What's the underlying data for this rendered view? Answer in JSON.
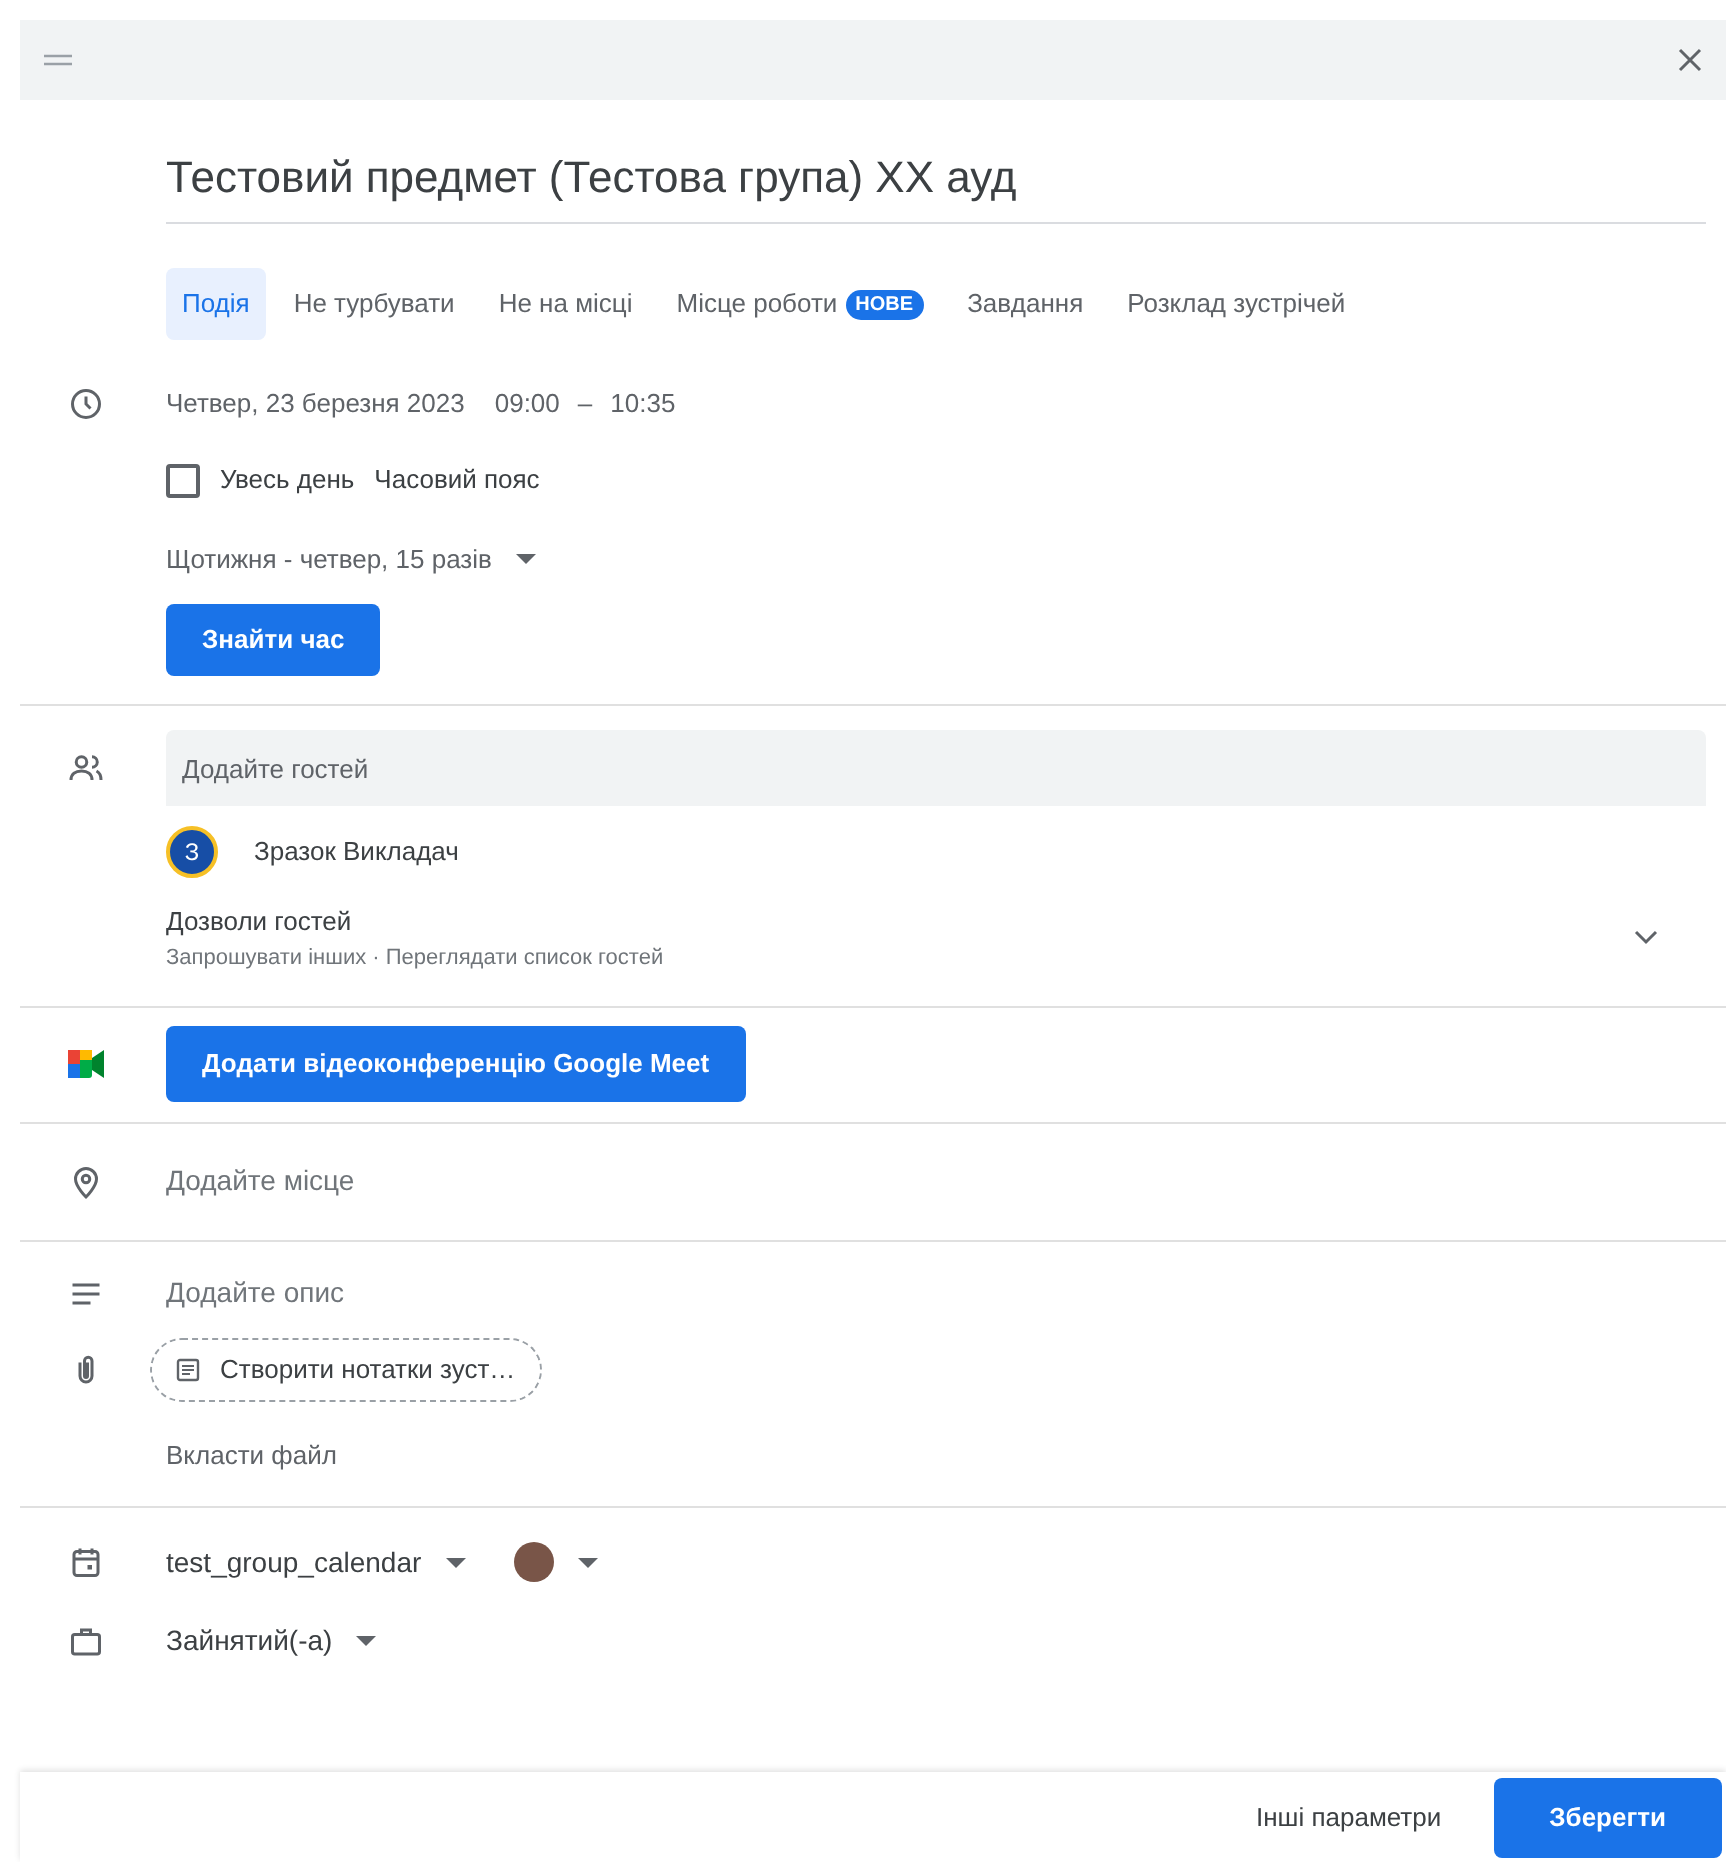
{
  "title": "Тестовий предмет (Тестова група) XX ауд",
  "tabs": [
    {
      "label": "Подія",
      "selected": true
    },
    {
      "label": "Не турбувати",
      "selected": false
    },
    {
      "label": "Не на місці",
      "selected": false
    },
    {
      "label": "Місце роботи",
      "selected": false,
      "badge": "НОВЕ"
    },
    {
      "label": "Завдання",
      "selected": false
    },
    {
      "label": "Розклад зустрічей",
      "selected": false
    }
  ],
  "time": {
    "date": "Четвер, 23 березня 2023",
    "start": "09:00",
    "dash": "–",
    "end": "10:35"
  },
  "all_day": {
    "label": "Увесь день",
    "checked": false
  },
  "timezone": "Часовий пояс",
  "recurrence": "Щотижня - четвер, 15 разів",
  "find_time_button": "Знайти час",
  "guests": {
    "placeholder": "Додайте гостей",
    "list": [
      {
        "initial": "З",
        "name": "Зразок Викладач"
      }
    ],
    "permissions": {
      "title": "Дозволи гостей",
      "summary": "Запрошувати інших · Переглядати список гостей",
      "expanded": false
    }
  },
  "meet_button": "Додати відеоконференцію Google Meet",
  "location": {
    "placeholder": "Додайте місце"
  },
  "description": {
    "placeholder": "Додайте опис"
  },
  "notes_button": "Створити нотатки зуст…",
  "attach_file": "Вкласти файл",
  "calendar": {
    "name": "test_group_calendar",
    "color": "#795548"
  },
  "availability": "Зайнятий(-а)",
  "footer": {
    "more_options": "Інші параметри",
    "save": "Зберегти"
  }
}
